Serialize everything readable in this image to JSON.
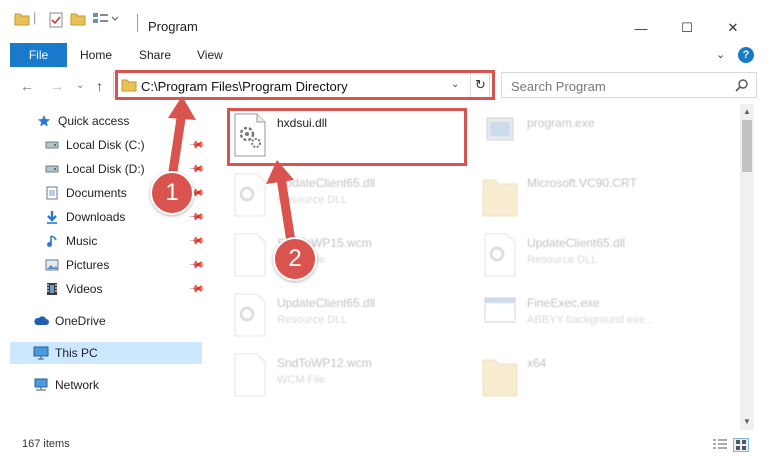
{
  "window": {
    "title": "Program",
    "controls": {
      "minimize": "—",
      "maximize": "☐",
      "close": "✕"
    }
  },
  "ribbon": {
    "tabs": [
      "File",
      "Home",
      "Share",
      "View"
    ],
    "chevron": "⌄",
    "help": "?"
  },
  "address": {
    "path": "C:\\Program Files\\Program Directory",
    "dropdown": "⌄",
    "refresh": "↻"
  },
  "search": {
    "placeholder": "Search Program"
  },
  "nav": {
    "back": "←",
    "forward": "→",
    "recent": "⌄",
    "up": "↑",
    "items": [
      {
        "label": "Quick access",
        "icon": "star-icon"
      },
      {
        "label": "Local Disk (C:)",
        "icon": "drive-icon",
        "pinned": true
      },
      {
        "label": "Local Disk (D:)",
        "icon": "drive-icon",
        "pinned": true
      },
      {
        "label": "Documents",
        "icon": "documents-icon",
        "pinned": true
      },
      {
        "label": "Downloads",
        "icon": "download-icon",
        "pinned": true
      },
      {
        "label": "Music",
        "icon": "music-icon",
        "pinned": true
      },
      {
        "label": "Pictures",
        "icon": "pictures-icon",
        "pinned": true
      },
      {
        "label": "Videos",
        "icon": "videos-icon",
        "pinned": true
      },
      {
        "label": "OneDrive",
        "icon": "cloud-icon"
      },
      {
        "label": "This PC",
        "icon": "computer-icon",
        "selected": true
      },
      {
        "label": "Network",
        "icon": "network-icon"
      }
    ]
  },
  "files": [
    {
      "name": "hxdsui.dll",
      "desc": "",
      "icon": "dll-icon",
      "highlighted": true
    },
    {
      "name": "program.exe",
      "desc": "",
      "icon": "exe-icon"
    },
    {
      "name": "UpdateClient65.dll",
      "desc": "Resource DLL",
      "icon": "dll-icon"
    },
    {
      "name": "Microsoft.VC90.CRT",
      "desc": "",
      "icon": "folder-icon"
    },
    {
      "name": "SndToWP15.wcm",
      "desc": "WCM File",
      "icon": "file-icon"
    },
    {
      "name": "UpdateClient65.dll",
      "desc": "Resource DLL",
      "icon": "dll-icon"
    },
    {
      "name": "UpdateClient65.dll",
      "desc": "Resource DLL",
      "icon": "dll-icon"
    },
    {
      "name": "FineExec.exe",
      "desc": "ABBYY background exe...",
      "icon": "exe-icon"
    },
    {
      "name": "SndToWP12.wcm",
      "desc": "WCM File",
      "icon": "file-icon"
    },
    {
      "name": "x64",
      "desc": "",
      "icon": "folder-icon"
    }
  ],
  "callouts": [
    "1",
    "2"
  ],
  "status": {
    "items": "167 items"
  },
  "colors": {
    "accent": "#1979ca",
    "highlight": "#d9534f",
    "selection": "#cce8ff"
  }
}
